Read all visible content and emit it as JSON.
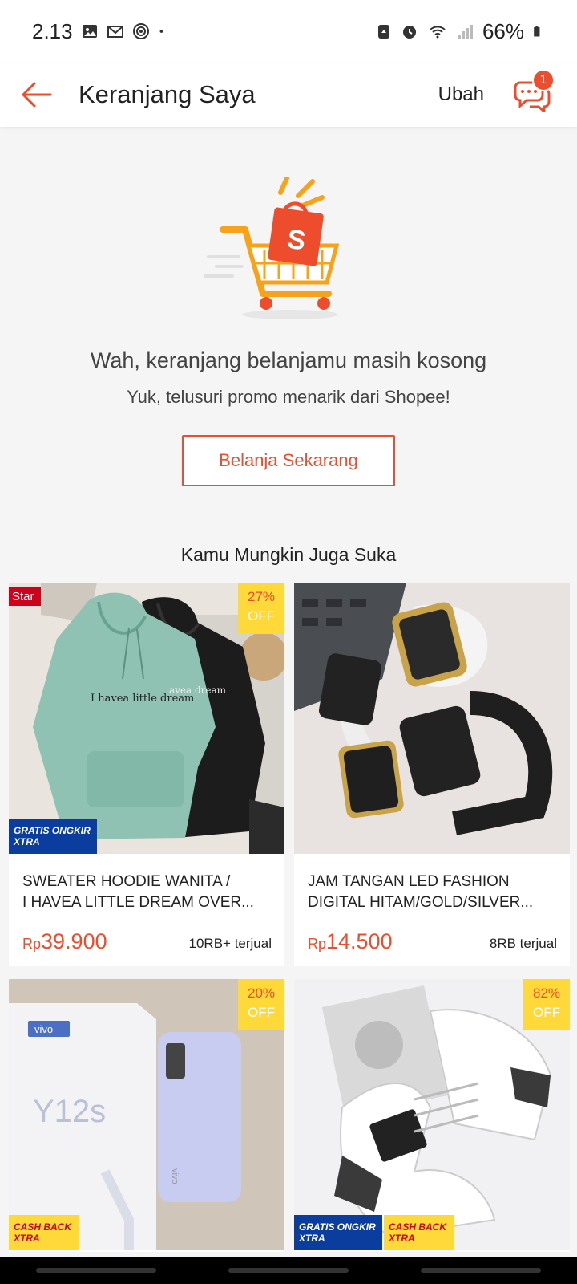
{
  "status_bar": {
    "time": "2.13",
    "battery": "66%",
    "icons": [
      "image-icon",
      "gmail-icon",
      "target-icon",
      "dot-icon",
      "recycle-icon",
      "alarm-icon",
      "wifi-icon",
      "signal-icon",
      "battery-icon"
    ]
  },
  "header": {
    "title": "Keranjang Saya",
    "action": "Ubah",
    "chat_badge": "1"
  },
  "empty_state": {
    "title": "Wah, keranjang belanjamu masih kosong",
    "subtitle": "Yuk, telusuri promo menarik dari Shopee!",
    "button": "Belanja Sekarang"
  },
  "recommendations": {
    "heading": "Kamu Mungkin Juga Suka",
    "items": [
      {
        "name_line1": "SWEATER HOODIE WANITA /",
        "name_line2": "I HAVEA LITTLE DREAM OVER...",
        "currency": "Rp",
        "price": "39.900",
        "sold": "10RB+ terjual",
        "discount": "27%",
        "off": "OFF",
        "star_tag": "Star",
        "promo": "GRATIS ONGKIR XTRA",
        "image_text_front": "I havea little dream",
        "image_text_back": "avea dream"
      },
      {
        "name_line1": "JAM TANGAN LED FASHION",
        "name_line2": "DIGITAL HITAM/GOLD/SILVER...",
        "currency": "Rp",
        "price": "14.500",
        "sold": "8RB terjual"
      },
      {
        "discount": "20%",
        "off": "OFF",
        "promo": "CASH BACK XTRA",
        "image_brand": "vivo",
        "image_model": "Y12s"
      },
      {
        "discount": "82%",
        "off": "OFF",
        "promo": "GRATIS ONGKIR XTRA",
        "promo2": "CASH BACK XTRA"
      }
    ]
  },
  "colors": {
    "accent": "#ee4d2d",
    "badge_yellow": "#ffd839",
    "promo_blue": "#0a3d9e",
    "background": "#f5f5f5"
  }
}
